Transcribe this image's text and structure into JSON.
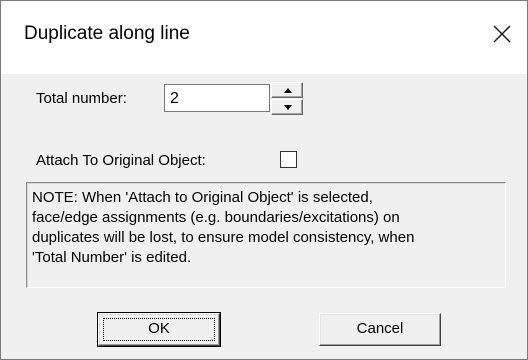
{
  "window": {
    "title": "Duplicate along line",
    "close_icon": "close-icon"
  },
  "total_number": {
    "label": "Total number:",
    "value": "2",
    "spin_up_icon": "triangle-up-icon",
    "spin_down_icon": "triangle-down-icon"
  },
  "attach": {
    "label": "Attach To Original Object:",
    "checked": false
  },
  "note": {
    "lines": [
      "NOTE:  When 'Attach to Original Object' is selected,",
      "face/edge assignments (e.g. boundaries/excitations) on",
      "duplicates will be lost, to ensure model consistency, when",
      "'Total Number' is edited."
    ]
  },
  "buttons": {
    "ok_label": "OK",
    "cancel_label": "Cancel"
  },
  "colors": {
    "title_background": "#ffffff",
    "client_background": "#f0f0f0",
    "border": "#7a7a7a"
  }
}
